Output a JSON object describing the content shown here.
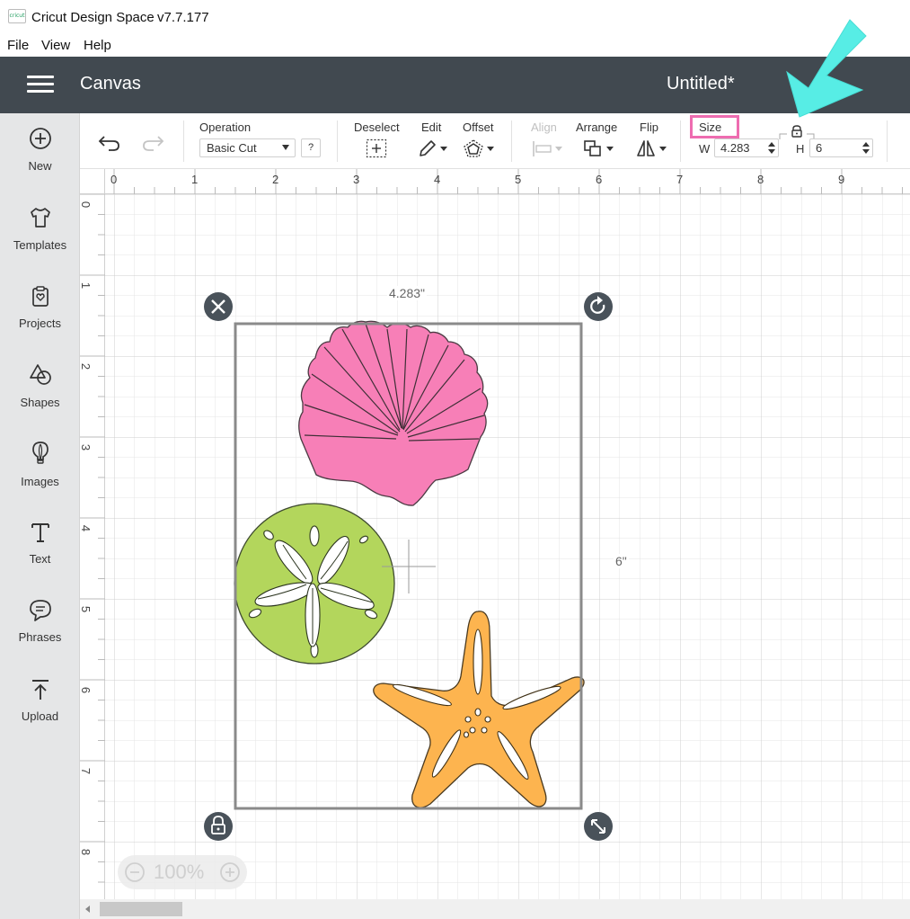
{
  "titlebar": {
    "logo_text": "cricut",
    "app_name": "Cricut Design Space",
    "version": "v7.7.177"
  },
  "menu": [
    "File",
    "View",
    "Help"
  ],
  "header": {
    "title": "Canvas",
    "document": "Untitled*"
  },
  "sidebar": {
    "items": [
      {
        "label": "New",
        "icon": "plus-circle-icon"
      },
      {
        "label": "Templates",
        "icon": "tshirt-icon"
      },
      {
        "label": "Projects",
        "icon": "projects-icon"
      },
      {
        "label": "Shapes",
        "icon": "shapes-icon"
      },
      {
        "label": "Images",
        "icon": "lightbulb-icon"
      },
      {
        "label": "Text",
        "icon": "text-icon"
      },
      {
        "label": "Phrases",
        "icon": "speech-bubble-icon"
      },
      {
        "label": "Upload",
        "icon": "upload-icon"
      }
    ]
  },
  "toolbar": {
    "operation_label": "Operation",
    "operation_value": "Basic Cut",
    "help_label": "?",
    "deselect_label": "Deselect",
    "edit_label": "Edit",
    "offset_label": "Offset",
    "align_label": "Align",
    "arrange_label": "Arrange",
    "flip_label": "Flip",
    "size_label": "Size",
    "width_label": "W",
    "width_value": "4.283",
    "height_label": "H",
    "height_value": "6"
  },
  "rulers": {
    "horizontal": [
      "0",
      "1",
      "2",
      "3",
      "4",
      "5",
      "6",
      "7",
      "8",
      "9"
    ],
    "vertical": [
      "0",
      "1",
      "2",
      "3",
      "4",
      "5",
      "6",
      "7",
      "8"
    ]
  },
  "selection": {
    "width_label": "4.283\"",
    "height_label": "6\""
  },
  "zoom": {
    "value": "100%"
  },
  "colors": {
    "header": "#414950",
    "shell": "#f77fb7",
    "sand_dollar": "#b3d65c",
    "starfish": "#fdb44f",
    "size_highlight": "#ee6cb0",
    "arrow": "#57ede5"
  }
}
